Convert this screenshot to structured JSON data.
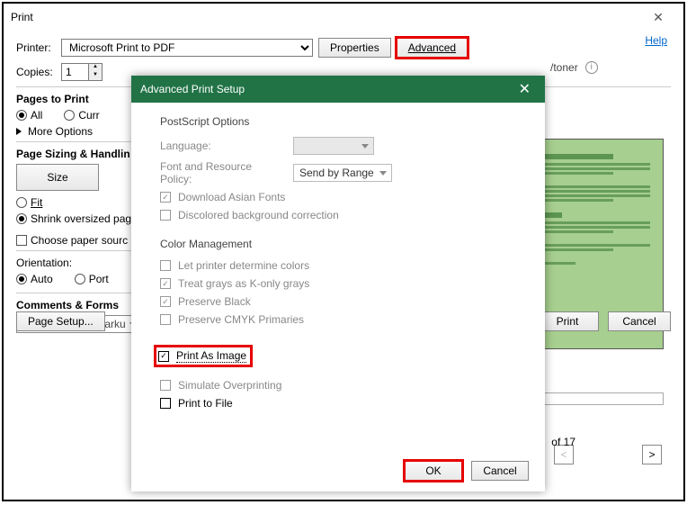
{
  "window": {
    "title": "Print"
  },
  "top": {
    "printer_label": "Printer:",
    "printer_value": "Microsoft Print to PDF",
    "properties_btn": "Properties",
    "advanced_btn": "Advanced",
    "help": "Help",
    "copies_label": "Copies:",
    "copies_value": "1",
    "ink_text": "/toner"
  },
  "pages": {
    "heading": "Pages to Print",
    "all": "All",
    "current": "Curr",
    "more": "More Options"
  },
  "sizing": {
    "heading": "Page Sizing & Handlin",
    "size_btn": "Size",
    "fit": "Fit",
    "shrink": "Shrink oversized pag",
    "choose_src": "Choose paper sourc"
  },
  "orientation": {
    "heading": "Orientation:",
    "auto": "Auto",
    "portrait": "Port"
  },
  "comments": {
    "heading": "Comments & Forms",
    "value": "Document and Marku"
  },
  "footer": {
    "page_setup": "Page Setup...",
    "print": "Print",
    "cancel": "Cancel",
    "of_label": "of 17",
    "lt": "<",
    "gt": ">"
  },
  "dialog": {
    "title": "Advanced Print Setup",
    "postscript": {
      "heading": "PostScript Options",
      "language_label": "Language:",
      "font_policy_label": "Font and Resource Policy:",
      "font_policy_value": "Send by Range",
      "download_asian": "Download Asian Fonts",
      "discolored": "Discolored background correction"
    },
    "color": {
      "heading": "Color Management",
      "let_printer": "Let printer determine colors",
      "treat_grays": "Treat grays as K-only grays",
      "preserve_black": "Preserve Black",
      "preserve_cmyk": "Preserve CMYK Primaries"
    },
    "print_as_image": "Print As Image",
    "simulate": "Simulate Overprinting",
    "print_to_file": "Print to File",
    "ok": "OK",
    "cancel": "Cancel"
  }
}
